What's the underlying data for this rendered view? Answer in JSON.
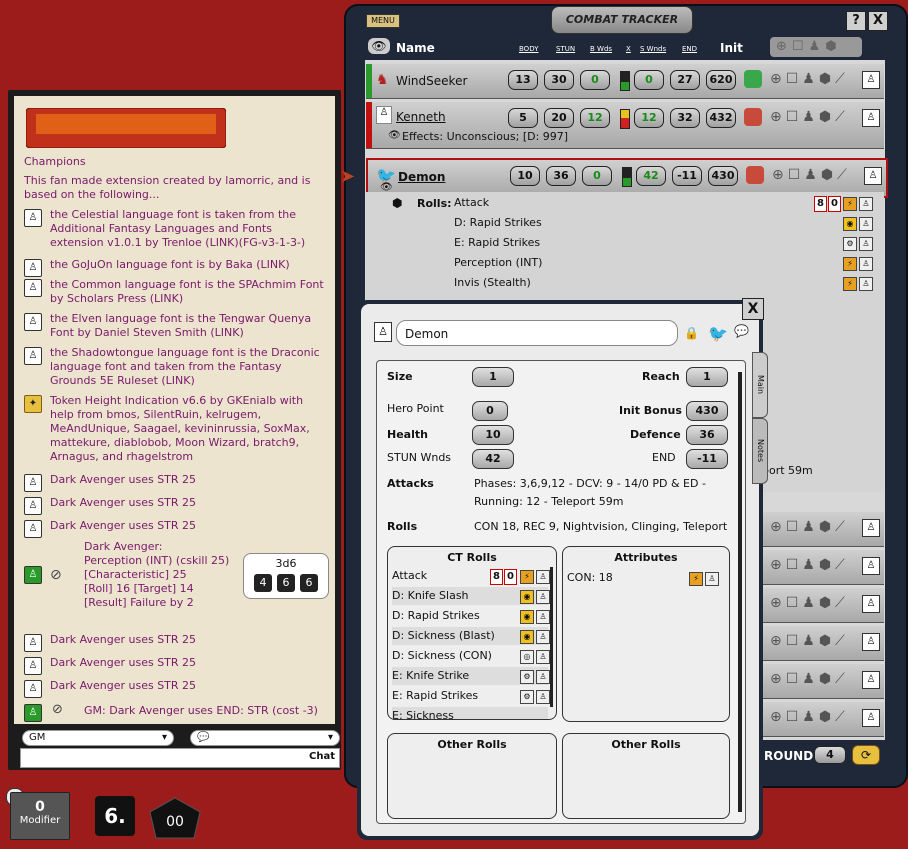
{
  "chat": {
    "lines": [
      {
        "text": "Champions"
      },
      {
        "text": "This fan made extension created by lamorric, and is based on the following..."
      },
      {
        "text": "the Celestial language font is taken from the Additional Fantasy Languages and Fonts extension v1.0.1 by Trenloe (LINK)(FG-v3-1-3-)"
      },
      {
        "text": "the GoJuOn language font is by Baka (LINK)"
      },
      {
        "text": "the Common language font is the SPAchmim Font by Scholars Press (LINK)"
      },
      {
        "text": "the Elven language font is the Tengwar Quenya Font by Daniel Steven Smith (LINK)"
      },
      {
        "text": "the Shadowtongue language font is the Draconic language font and taken from the Fantasy Grounds 5E Ruleset (LINK)"
      },
      {
        "text": "Token Height Indication v6.6 by GKEnialb with help from bmos, SilentRuin, kelrugem, MeAndUnique, Saagael, kevininrussia, SoxMax, mattekure, diablobob, Moon Wizard, bratch9, Arnagus, and rhagelstrom"
      },
      {
        "text": "Dark Avenger uses STR 25"
      },
      {
        "text": "Dark Avenger uses STR 25"
      },
      {
        "text": "Dark Avenger uses STR 25"
      }
    ],
    "roll": {
      "line1": "Dark Avenger:",
      "line2": "Perception (INT) (cskill 25)",
      "line3": "[Characteristic] 25",
      "line4": "[Roll] 16 [Target] 14",
      "line5": "[Result] Failure by 2",
      "dice_label": "3d6",
      "dice": [
        "4",
        "6",
        "6"
      ]
    },
    "lines2": [
      {
        "text": "Dark Avenger uses STR 25"
      },
      {
        "text": "Dark Avenger uses STR 25"
      },
      {
        "text": "Dark Avenger uses STR 25"
      }
    ],
    "gm_line": "GM:  Dark Avenger uses END: STR  (cost -3)",
    "identity_select": "GM",
    "chat_button": "Chat"
  },
  "modifier": {
    "value": "0",
    "label": "Modifier"
  },
  "hotkey": "6.",
  "d100": "00",
  "ct": {
    "menu": "MENU",
    "title": "COMBAT TRACKER",
    "help": "?",
    "close": "X",
    "header": {
      "name": "Name",
      "body": "BODY",
      "stun": "STUN",
      "bwds": "B Wds",
      "x": "X",
      "swds": "S Wnds",
      "end": "END",
      "init": "Init"
    },
    "rows": [
      {
        "name": "WindSeeker",
        "body": "13",
        "stun": "30",
        "bwds": "0",
        "swds": "0",
        "end": "27",
        "init": "620"
      },
      {
        "name": "Kenneth",
        "body": "5",
        "stun": "20",
        "bwds": "12",
        "swds": "12",
        "end": "32",
        "init": "432",
        "effects": "Effects: Unconscious; [D: 997]"
      },
      {
        "name": "Demon",
        "body": "10",
        "stun": "36",
        "bwds": "0",
        "swds": "42",
        "end": "-11",
        "init": "430"
      }
    ],
    "rolls_label": "Rolls:",
    "attack": {
      "name": "Attack",
      "a": "8",
      "b": "0"
    },
    "rolls": [
      "D: Rapid Strikes",
      "E: Rapid Strikes",
      "Perception (INT)",
      "Invis (Stealth)"
    ],
    "teleport": "port 59m",
    "round_label": "ROUND",
    "round_value": "4"
  },
  "sheet": {
    "close": "X",
    "name": "Demon",
    "tab_main": "Main",
    "tab_notes": "Notes",
    "fields": {
      "size_label": "Size",
      "size": "1",
      "reach_label": "Reach",
      "reach": "1",
      "hero_label": "Hero Point",
      "hero": "0",
      "initb_label": "Init Bonus",
      "initb": "430",
      "health_label": "Health",
      "health": "10",
      "defence_label": "Defence",
      "defence": "36",
      "stun_label": "STUN Wnds",
      "stun": "42",
      "end_label": "END",
      "end": "-11"
    },
    "attacks_label": "Attacks",
    "attacks_text1": "Phases: 3,6,9,12 - DCV: 9 - 14/0 PD & ED -",
    "attacks_text2": "Running: 12 - Teleport 59m",
    "rolls_label": "Rolls",
    "rolls_text": "CON 18, REC 9, Nightvision, Clinging, Teleport",
    "ct_rolls_title": "CT Rolls",
    "ct_rolls": [
      {
        "name": "Attack",
        "a": "8",
        "b": "0"
      },
      {
        "name": "D: Knife Slash"
      },
      {
        "name": "D: Rapid Strikes"
      },
      {
        "name": "D: Sickness (Blast)"
      },
      {
        "name": "D: Sickness (CON)"
      },
      {
        "name": "E: Knife Strike"
      },
      {
        "name": "E: Rapid Strikes"
      },
      {
        "name": "E: Sickness"
      }
    ],
    "attributes_title": "Attributes",
    "attribute_1": "CON: 18",
    "other_rolls_1": "Other Rolls",
    "other_rolls_2": "Other Rolls"
  },
  "colors": {
    "background": "#9c1c1c",
    "frame": "#1e2838",
    "chat_text": "#7a1a6a",
    "green": "#1a8a1a"
  }
}
